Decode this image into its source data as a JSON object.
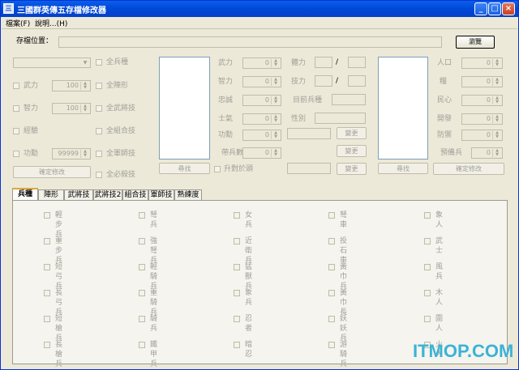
{
  "window": {
    "title": "三國群英傳五存檔修改器",
    "min": "_",
    "max": "□",
    "close": "×"
  },
  "menu": {
    "file": "檔案(F)",
    "help": "說明...(H)"
  },
  "save": {
    "label": "存檔位置：",
    "browse": "瀏覽"
  },
  "left": {
    "all_soldiers": "全兵種",
    "all_formations": "全陣形",
    "all_skills": "全武將技",
    "all_combos": "全組合技",
    "all_army_skills": "全軍師技",
    "all_kill_skills": "全必殺技",
    "force_label": "武力",
    "force_value": "100",
    "intel_label": "智力",
    "intel_value": "100",
    "exp_label": "經驗",
    "merit_label": "功勳",
    "merit_value": "99999",
    "confirm": "確定修改"
  },
  "mid": {
    "force": "武力",
    "intel": "智力",
    "loyalty": "忠誠",
    "morale": "士氣",
    "merit": "功勳",
    "troops": "帶兵數",
    "hp": "體力",
    "mp": "技力",
    "cur_soldier": "目前兵種",
    "gender": "性別",
    "zero": "0",
    "slash": "/",
    "change": "變更",
    "find": "尋找",
    "promote": "升對於頭"
  },
  "right": {
    "population": "人口",
    "gold": "糧",
    "morale": "民心",
    "development": "開發",
    "defense": "防禦",
    "reserve": "預備兵",
    "zero": "0",
    "find": "尋找",
    "confirm": "確定修改"
  },
  "tabs": [
    "兵種",
    "陣形",
    "武將技",
    "武將技2",
    "組合技",
    "軍師技",
    "熟練度"
  ],
  "soldiers": [
    [
      "輕步兵",
      "弩兵",
      "女兵",
      "弩車",
      "象人"
    ],
    [
      "重步兵",
      "強弩兵",
      "近衛兵",
      "投石車",
      "武士"
    ],
    [
      "短弓兵",
      "輕騎兵",
      "猛獸兵",
      "黃巾兵",
      "風兵"
    ],
    [
      "長弓兵",
      "重騎兵",
      "象兵",
      "黃巾長",
      "木人"
    ],
    [
      "短槍兵",
      "騎兵",
      "忍者",
      "妖妖兵",
      "圍人"
    ],
    [
      "長槍兵",
      "鐵甲兵",
      "暗忍",
      "游騎兵",
      "火人"
    ]
  ],
  "watermark": "ITMOP.COM"
}
